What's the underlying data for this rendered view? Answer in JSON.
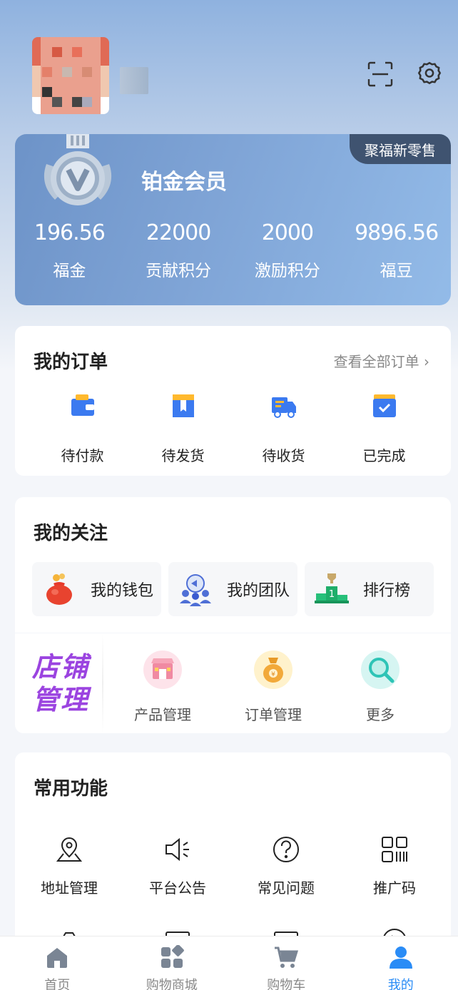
{
  "header": {
    "scan_icon": "scan-icon",
    "settings_icon": "gear-icon"
  },
  "member_card": {
    "store_tag": "聚福新零售",
    "level": "铂金会员",
    "stats": [
      {
        "value": "196.56",
        "label": "福金"
      },
      {
        "value": "22000",
        "label": "贡献积分"
      },
      {
        "value": "2000",
        "label": "激励积分"
      },
      {
        "value": "9896.56",
        "label": "福豆"
      }
    ]
  },
  "orders": {
    "title": "我的订单",
    "view_all": "查看全部订单 ›",
    "items": [
      {
        "label": "待付款",
        "icon": "wallet-icon"
      },
      {
        "label": "待发货",
        "icon": "package-icon"
      },
      {
        "label": "待收货",
        "icon": "truck-icon"
      },
      {
        "label": "已完成",
        "icon": "completed-box-icon"
      }
    ]
  },
  "follow": {
    "title": "我的关注",
    "items": [
      {
        "label": "我的钱包",
        "icon": "money-bag-icon"
      },
      {
        "label": "我的团队",
        "icon": "team-icon"
      },
      {
        "label": "排行榜",
        "icon": "podium-icon"
      }
    ]
  },
  "shop": {
    "title_line1": "店铺",
    "title_line2": "管理",
    "items": [
      {
        "label": "产品管理",
        "icon": "store-icon"
      },
      {
        "label": "订单管理",
        "icon": "order-bag-icon"
      },
      {
        "label": "更多",
        "icon": "magnifier-icon"
      }
    ]
  },
  "functions": {
    "title": "常用功能",
    "items": [
      {
        "label": "地址管理",
        "icon": "location-icon"
      },
      {
        "label": "平台公告",
        "icon": "speaker-icon"
      },
      {
        "label": "常见问题",
        "icon": "question-icon"
      },
      {
        "label": "推广码",
        "icon": "qrcode-icon"
      }
    ]
  },
  "tabbar": {
    "items": [
      {
        "label": "首页",
        "icon": "home-icon"
      },
      {
        "label": "购物商城",
        "icon": "apps-icon"
      },
      {
        "label": "购物车",
        "icon": "cart-icon"
      },
      {
        "label": "我的",
        "icon": "user-icon"
      }
    ],
    "active_color": "#2a8cf6"
  }
}
